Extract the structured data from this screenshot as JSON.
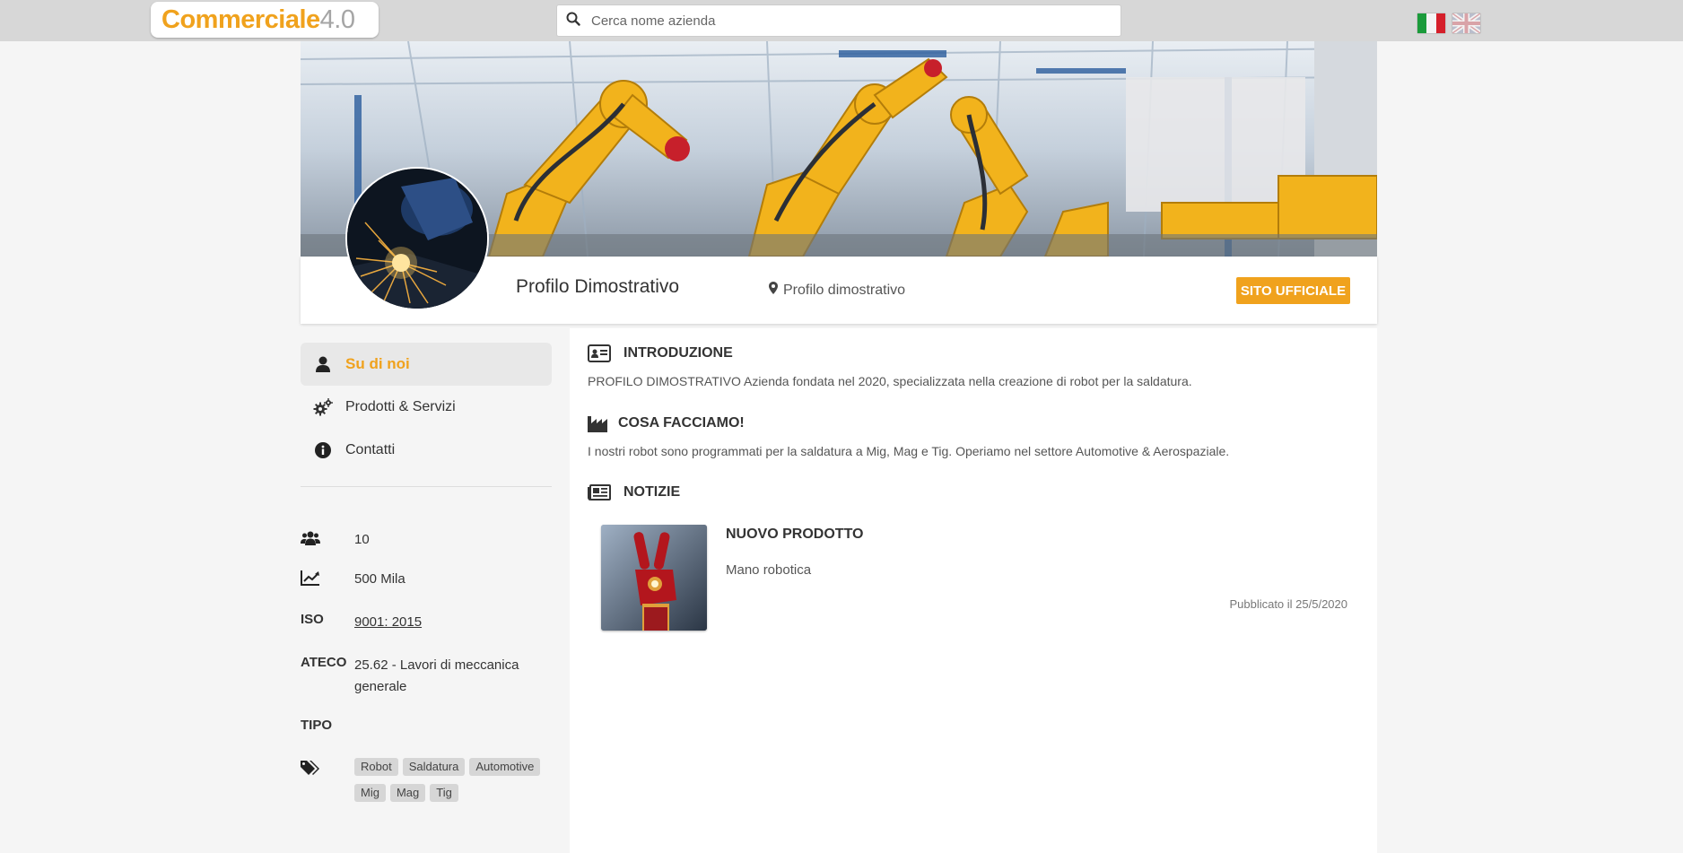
{
  "header": {
    "logo_part1": "Commerciale",
    "logo_part2": "4.0",
    "search_placeholder": "Cerca nome azienda",
    "languages": [
      "it",
      "en"
    ],
    "accent_color": "#f0a21d"
  },
  "profile": {
    "name": "Profilo Dimostrativo",
    "location": "Profilo dimostrativo",
    "site_button": "SITO UFFICIALE"
  },
  "sidebar": {
    "items": [
      {
        "label": "Su di noi",
        "icon": "user-icon",
        "active": true
      },
      {
        "label": "Prodotti & Servizi",
        "icon": "gears-icon",
        "active": false
      },
      {
        "label": "Contatti",
        "icon": "info-circle-icon",
        "active": false
      }
    ],
    "stats": {
      "employees": "10",
      "revenue": "500 Mila",
      "iso_label": "ISO",
      "iso_value": "9001: 2015",
      "ateco_label": "ATECO",
      "ateco_value": "25.62 - Lavori di meccanica generale",
      "tipo_label": "TIPO"
    },
    "tags": [
      "Robot",
      "Saldatura",
      "Automotive",
      "Mig",
      "Mag",
      "Tig"
    ]
  },
  "main": {
    "intro_title": "INTRODUZIONE",
    "intro_text": "PROFILO DIMOSTRATIVO Azienda fondata nel 2020, specializzata nella creazione di robot per la saldatura.",
    "what_title": "COSA FACCIAMO!",
    "what_text": "I nostri robot sono programmati per la saldatura a Mig, Mag e Tig. Operiamo nel settore Automotive & Aerospaziale.",
    "news_title": "NOTIZIE",
    "news": {
      "title": "NUOVO PRODOTTO",
      "description": "Mano robotica",
      "date": "Pubblicato il 25/5/2020"
    }
  }
}
